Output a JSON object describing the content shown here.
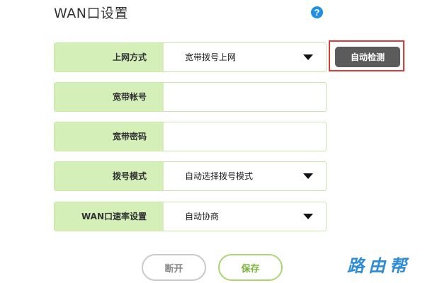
{
  "header": {
    "title": "WAN口设置",
    "help_icon": "question-mark-icon",
    "help_glyph": "?"
  },
  "colors": {
    "label_bg": "#d4f0b8",
    "row_border": "#c9e6a8",
    "detect_button": "#5b5b5b",
    "highlight_frame": "#e0393b",
    "save_accent": "#7cb33d",
    "help_icon": "#1f8fe3",
    "watermark": "#2e8bd6"
  },
  "form": {
    "connection_type": {
      "label": "上网方式",
      "value": "宽带拨号上网",
      "icon": "dropdown-caret-icon"
    },
    "account": {
      "label": "宽带帐号",
      "value": ""
    },
    "password": {
      "label": "宽带密码",
      "value": ""
    },
    "dial_mode": {
      "label": "拨号模式",
      "value": "自动选择拨号模式",
      "icon": "dropdown-caret-icon"
    },
    "wan_speed": {
      "label": "WAN口速率设置",
      "value": "自动协商",
      "icon": "dropdown-caret-icon"
    }
  },
  "buttons": {
    "auto_detect": "自动检测",
    "disconnect": "断开",
    "save": "保存"
  },
  "watermark": "路由帮"
}
